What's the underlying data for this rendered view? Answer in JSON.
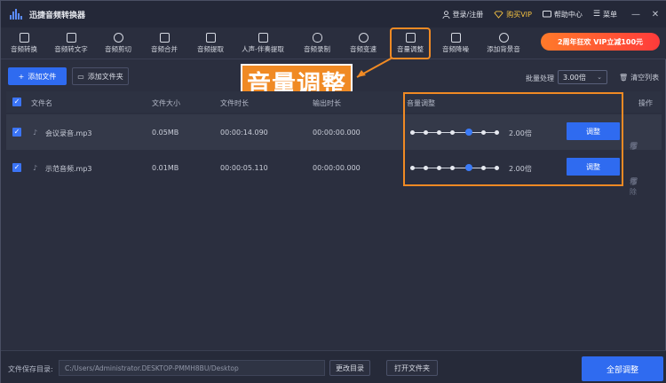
{
  "app": {
    "title": "迅捷音频转换器"
  },
  "titlebar": {
    "login": "登录/注册",
    "vip": "购买VIP",
    "help": "帮助中心",
    "menu": "菜单",
    "minimize": "—",
    "close": "✕"
  },
  "toolbar": {
    "items": [
      {
        "label": "音频转换",
        "icon": "convert-icon"
      },
      {
        "label": "音频转文字",
        "icon": "text-icon"
      },
      {
        "label": "音频剪切",
        "icon": "scissors-icon"
      },
      {
        "label": "音频合并",
        "icon": "merge-icon"
      },
      {
        "label": "音频提取",
        "icon": "extract-icon"
      },
      {
        "label": "人声-伴奏提取",
        "icon": "vocal-icon"
      },
      {
        "label": "音频录制",
        "icon": "mic-icon"
      },
      {
        "label": "音频变速",
        "icon": "speed-icon"
      },
      {
        "label": "音量调整",
        "icon": "volume-icon",
        "active": true
      },
      {
        "label": "音频降噪",
        "icon": "denoise-icon"
      },
      {
        "label": "添加背景音",
        "icon": "bgm-icon"
      }
    ],
    "promo": "2周年狂欢 VIP立减100元"
  },
  "actions": {
    "add_file": "添加文件",
    "add_folder": "添加文件夹",
    "batch_label": "批量处理",
    "batch_value": "3.00倍",
    "clear_list": "清空列表"
  },
  "annotation": "音量调整",
  "table": {
    "headers": {
      "name": "文件名",
      "size": "文件大小",
      "duration": "文件时长",
      "output_duration": "输出时长",
      "volume": "音量调整",
      "ops": "操作"
    },
    "rows": [
      {
        "name": "会议录音.mp3",
        "size": "0.05MB",
        "duration": "00:00:14.090",
        "output": "00:00:00.000",
        "volume_label": "2.00倍",
        "volume_level": 2.0,
        "adjust": "调整",
        "remove": "移除"
      },
      {
        "name": "示范音频.mp3",
        "size": "0.01MB",
        "duration": "00:00:05.110",
        "output": "00:00:00.000",
        "volume_label": "2.00倍",
        "volume_level": 2.0,
        "adjust": "调整",
        "remove": "移除"
      }
    ]
  },
  "bottom": {
    "save_label": "文件保存目录:",
    "path": "C:/Users/Administrator.DESKTOP-PMMH8BU/Desktop",
    "change_dir": "更改目录",
    "open_folder": "打开文件夹",
    "all_adjust": "全部调整"
  },
  "colors": {
    "accent": "#2f6bf0",
    "highlight": "#f08a24",
    "background": "#2b2f3f"
  }
}
